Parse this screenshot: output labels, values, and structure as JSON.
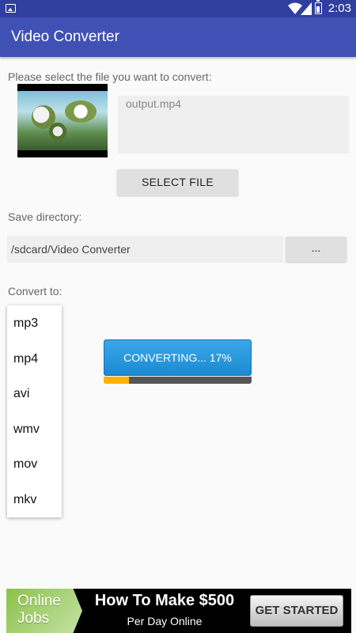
{
  "status_bar": {
    "time": "2:03",
    "icons": [
      "picture-icon",
      "wifi-icon",
      "signal-icon",
      "battery-icon"
    ]
  },
  "app_bar": {
    "title": "Video Converter"
  },
  "file_section": {
    "prompt": "Please select the file you want to convert:",
    "file_name": "output.mp4",
    "select_button": "SELECT FILE"
  },
  "directory_section": {
    "label": "Save directory:",
    "path": "/sdcard/Video Converter",
    "browse_button": "..."
  },
  "convert_section": {
    "label": "Convert to:",
    "formats": [
      "mp3",
      "mp4",
      "avi",
      "wmv",
      "mov",
      "mkv"
    ],
    "convert_button": "CONVERTING... 17%",
    "progress_percent": 17
  },
  "ad": {
    "logo_line1": "Online",
    "logo_line2": "Jobs",
    "headline": "How To Make $500",
    "subline": "Per Day Online",
    "cta": "GET STARTED"
  },
  "colors": {
    "status_bar": "#303f9f",
    "app_bar": "#3f51b5",
    "convert_button": "#1a8ad4",
    "progress_fill": "#ffb300"
  }
}
